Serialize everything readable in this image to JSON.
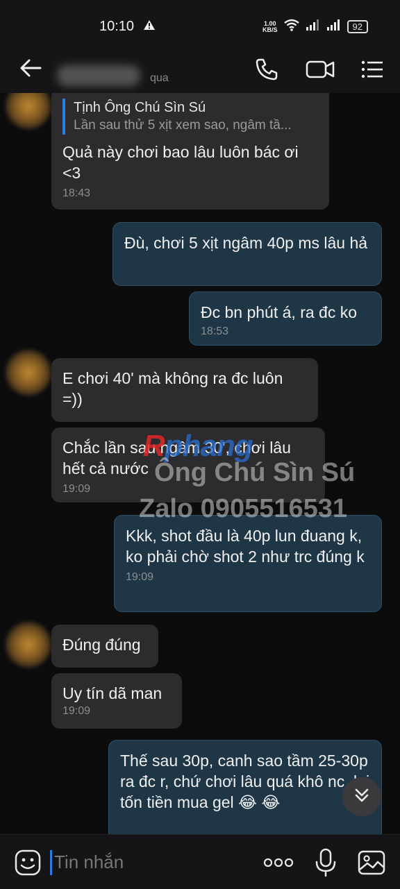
{
  "status": {
    "time": "10:10",
    "net_speed_top": "1.00",
    "net_speed_bottom": "KB/S",
    "battery": "92"
  },
  "header": {
    "subtitle": "qua"
  },
  "messages": [
    {
      "id": "m1",
      "direction": "in",
      "quote": {
        "name": "Tịnh Ông Chú Sìn Sú",
        "text": "Lần sau thử 5 xịt xem sao, ngâm tầ..."
      },
      "text": "Quả này chơi bao lâu luôn bác ơi <3",
      "time": "18:43"
    },
    {
      "id": "m2",
      "direction": "out",
      "text": "Đù, chơi 5 xịt ngâm 40p ms lâu hả",
      "time": ""
    },
    {
      "id": "m3",
      "direction": "out",
      "text": "Đc bn phút á, ra đc ko",
      "time": "18:53"
    },
    {
      "id": "m4",
      "direction": "in",
      "text": "E chơi 40' mà không ra đc luôn =))",
      "time": ""
    },
    {
      "id": "m5",
      "direction": "in",
      "text": "Chắc lần sau ngâm 30', chơi lâu hết cả nước",
      "time": "19:09"
    },
    {
      "id": "m6",
      "direction": "out",
      "text": "Kkk, shot đầu là 40p lun đuang k, ko phải chờ shot 2 như trc đúng k",
      "time": "19:09"
    },
    {
      "id": "m7",
      "direction": "in",
      "text": "Đúng đúng",
      "time": ""
    },
    {
      "id": "m8",
      "direction": "in",
      "text": "Uy tín dã man",
      "time": "19:09"
    },
    {
      "id": "m9",
      "direction": "out",
      "text": "Thế sau 30p, canh sao tầm 25-30p ra đc r, chứ chơi lâu quá khô nc, lại tốn tiền mua gel 😂 😂",
      "time": ""
    }
  ],
  "watermark": {
    "brand_a": "R",
    "brand_b": "phang",
    "line1": "Ông Chú Sìn Sú",
    "line2": "Zalo 0905516531"
  },
  "composer": {
    "placeholder": "Tin nhắn"
  },
  "colors": {
    "accent": "#2a7de1",
    "incoming_bubble": "#2c2c2e",
    "outgoing_bubble": "#1f3646",
    "background": "#0c0c0d"
  }
}
